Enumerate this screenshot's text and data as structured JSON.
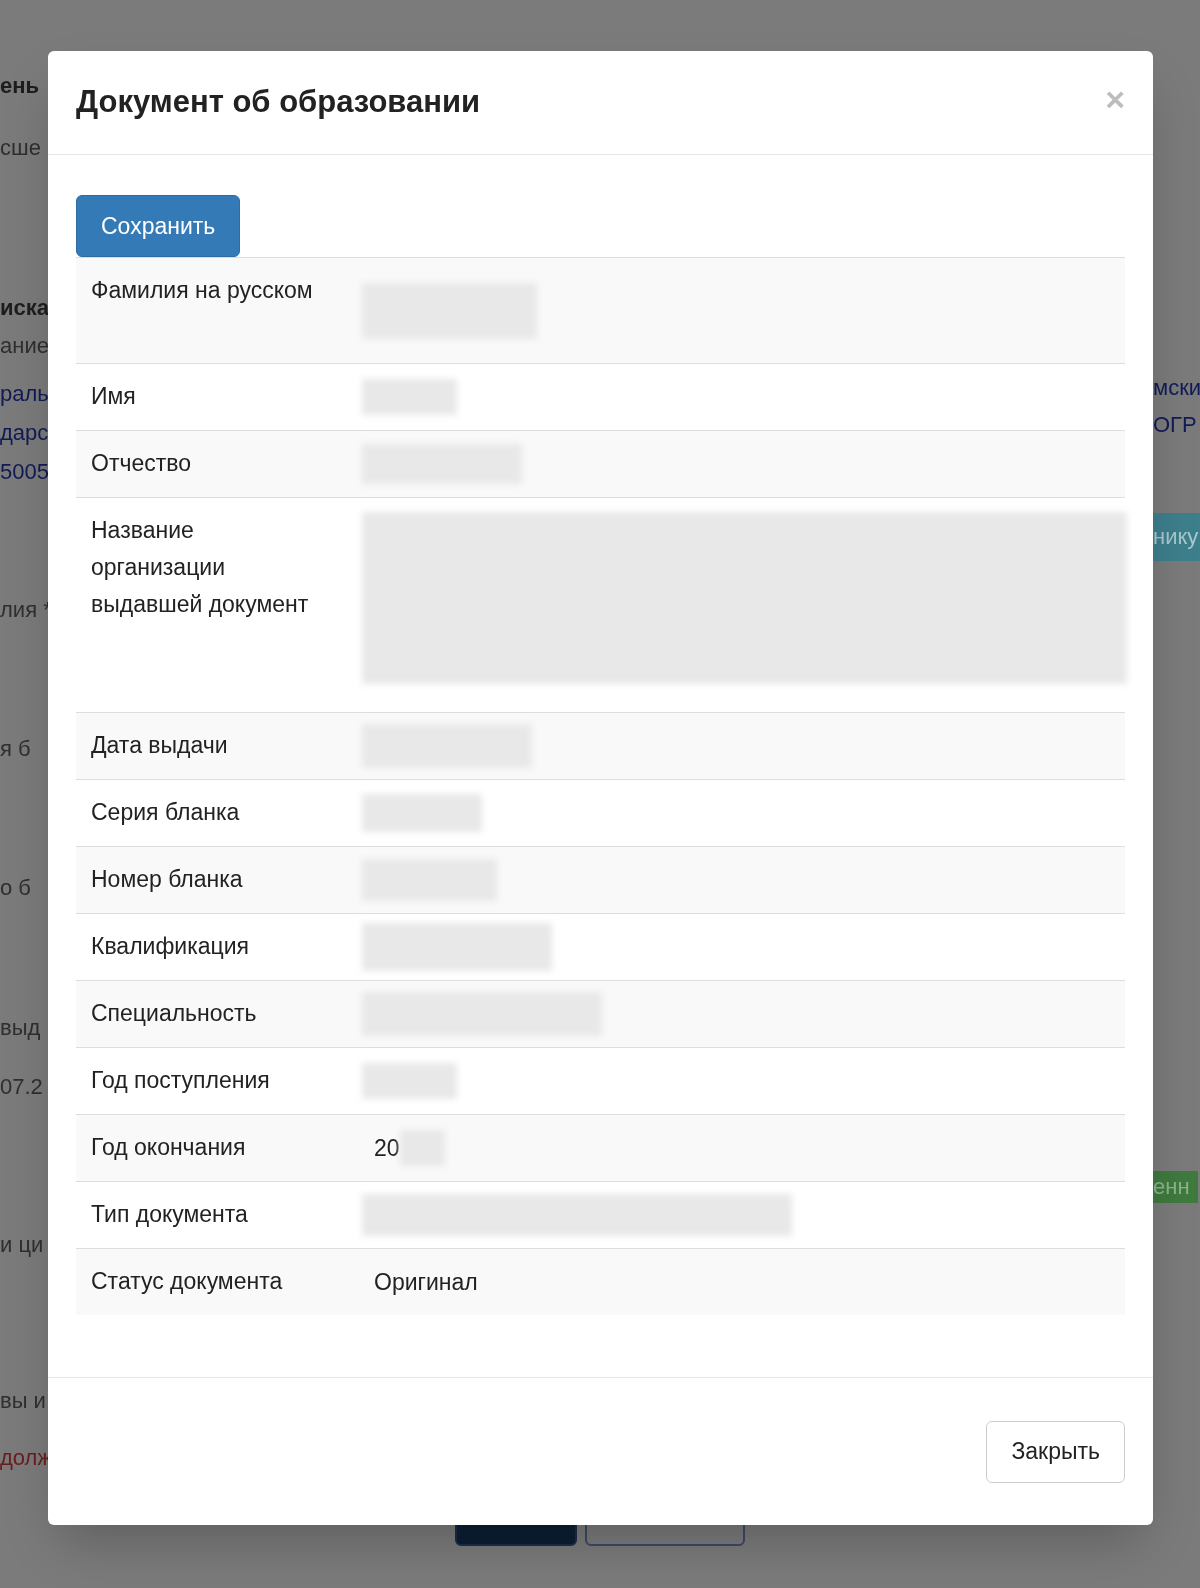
{
  "background": {
    "left_fragments": [
      "ень",
      "сше",
      "иска",
      "ание",
      "раль",
      "дарс",
      "5005",
      "лия *",
      "я б",
      "о б",
      "выд",
      "07.2",
      "и ци",
      "вы и",
      "долж"
    ],
    "right_fragments": [
      "мски",
      "ОГР",
      "нику",
      "енн"
    ]
  },
  "modal": {
    "title": "Документ об образовании",
    "close_icon": "×",
    "save_button": "Сохранить",
    "rows": [
      {
        "label": "Фамилия на русском",
        "redacted": true
      },
      {
        "label": "Имя",
        "redacted": true
      },
      {
        "label": "Отчество",
        "redacted": true
      },
      {
        "label": "Название организации выдавшей документ",
        "redacted": true
      },
      {
        "label": "Дата выдачи",
        "redacted": true
      },
      {
        "label": "Серия бланка",
        "redacted": true
      },
      {
        "label": "Номер бланка",
        "redacted": true
      },
      {
        "label": "Квалификация",
        "redacted": true
      },
      {
        "label": "Специальность",
        "redacted": true
      },
      {
        "label": "Год поступления",
        "redacted": true
      },
      {
        "label": "Год окончания",
        "value": "20",
        "redacted": true
      },
      {
        "label": "Тип документа",
        "redacted": true
      },
      {
        "label": "Статус документа",
        "value": "Оригинал",
        "redacted": false
      }
    ],
    "close_button": "Закрыть"
  }
}
